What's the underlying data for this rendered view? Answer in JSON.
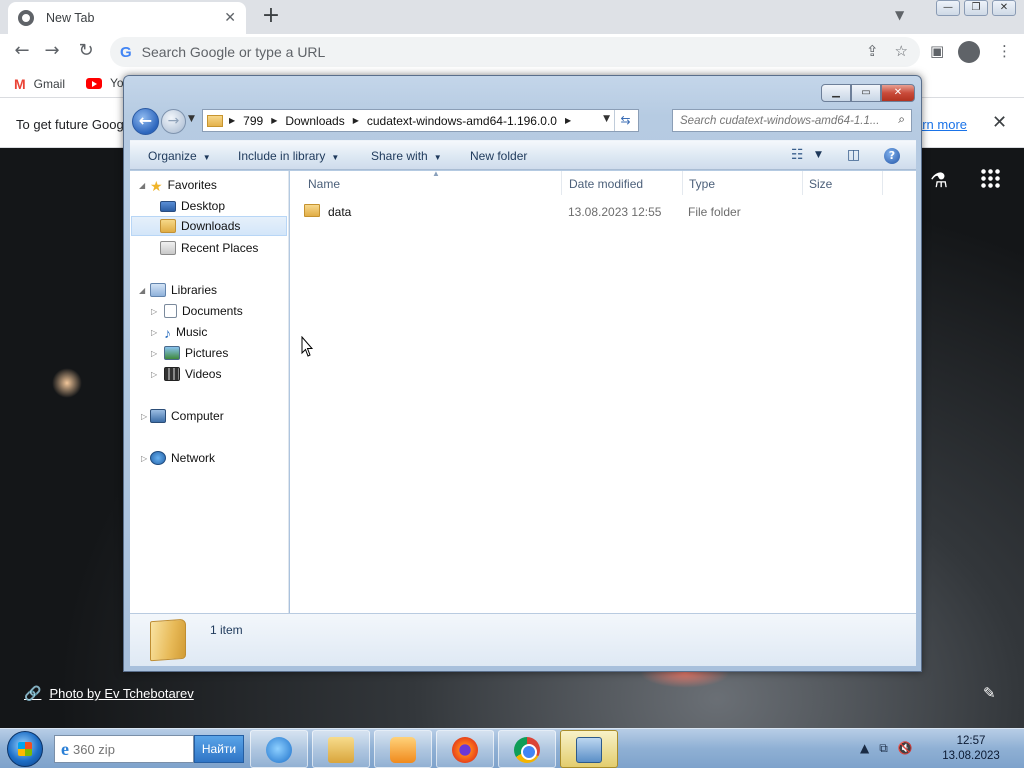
{
  "chrome": {
    "tab_title": "New Tab",
    "omnibox_placeholder": "Search Google or type a URL",
    "bookmarks": [
      "Gmail",
      "Yo"
    ],
    "info_text": "To get future Goog",
    "learn_more": "arn more",
    "photo_credit": "Photo by Ev Tchebotarev"
  },
  "explorer": {
    "breadcrumbs": [
      "799",
      "Downloads",
      "cudatext-windows-amd64-1.196.0.0"
    ],
    "search_placeholder": "Search cudatext-windows-amd64-1.1...",
    "commands": {
      "organize": "Organize",
      "include_in_library": "Include in library",
      "share_with": "Share with",
      "new_folder": "New folder"
    },
    "nav": {
      "favorites": "Favorites",
      "desktop": "Desktop",
      "downloads": "Downloads",
      "recent_places": "Recent Places",
      "libraries": "Libraries",
      "documents": "Documents",
      "music": "Music",
      "pictures": "Pictures",
      "videos": "Videos",
      "computer": "Computer",
      "network": "Network"
    },
    "columns": {
      "name": "Name",
      "date_modified": "Date modified",
      "type": "Type",
      "size": "Size"
    },
    "files": [
      {
        "name": "data",
        "date_modified": "13.08.2023 12:55",
        "type": "File folder",
        "size": ""
      }
    ],
    "item_count": "1 item"
  },
  "taskbar": {
    "search_placeholder": "360 zip",
    "search_button": "Найти",
    "time": "12:57",
    "date": "13.08.2023"
  },
  "colors": {
    "explorer_frame": "#b6cbe2",
    "selection": "#d4e6f9",
    "chrome_tabbar": "#dee1e6"
  }
}
